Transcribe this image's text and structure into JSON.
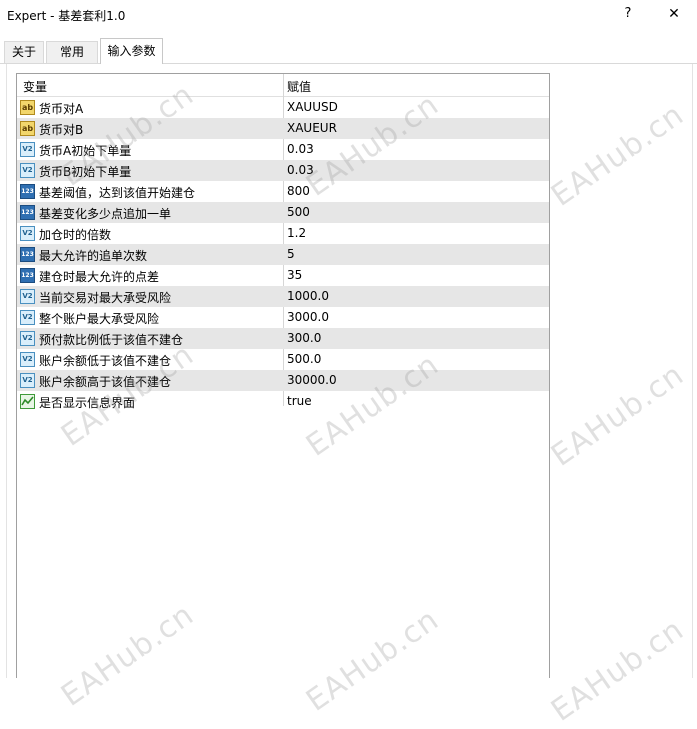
{
  "window": {
    "title": "Expert - 基差套利1.0",
    "help": "?",
    "close": "✕"
  },
  "tabs": [
    {
      "label": "关于",
      "active": false
    },
    {
      "label": "常用",
      "active": false
    },
    {
      "label": "输入参数",
      "active": true
    }
  ],
  "table": {
    "headers": {
      "variable": "变量",
      "value": "赋值"
    },
    "rows": [
      {
        "icon": "ab-string-icon",
        "name": "货币对A",
        "value": "XAUUSD"
      },
      {
        "icon": "ab-string-icon",
        "name": "货币对B",
        "value": "XAUEUR"
      },
      {
        "icon": "va-double-icon",
        "name": "货币A初始下单量",
        "value": "0.03"
      },
      {
        "icon": "va-double-icon",
        "name": "货币B初始下单量",
        "value": "0.03"
      },
      {
        "icon": "int-123-icon",
        "name": "基差阈值，达到该值开始建仓",
        "value": "800"
      },
      {
        "icon": "int-123-icon",
        "name": "基差变化多少点追加一单",
        "value": "500"
      },
      {
        "icon": "va-double-icon",
        "name": "加仓时的倍数",
        "value": "1.2"
      },
      {
        "icon": "int-123-icon",
        "name": "最大允许的追单次数",
        "value": "5"
      },
      {
        "icon": "int-123-icon",
        "name": "建仓时最大允许的点差",
        "value": "35"
      },
      {
        "icon": "va-double-icon",
        "name": "当前交易对最大承受风险",
        "value": "1000.0"
      },
      {
        "icon": "va-double-icon",
        "name": "整个账户最大承受风险",
        "value": "3000.0"
      },
      {
        "icon": "va-double-icon",
        "name": "预付款比例低于该值不建仓",
        "value": "300.0"
      },
      {
        "icon": "va-double-icon",
        "name": "账户余额低于该值不建仓",
        "value": "500.0"
      },
      {
        "icon": "va-double-icon",
        "name": "账户余额高于该值不建仓",
        "value": "30000.0"
      },
      {
        "icon": "bool-icon",
        "name": "是否显示信息界面",
        "value": "true"
      }
    ]
  },
  "watermark": {
    "text": "EAHub.cn"
  },
  "icon_labels": {
    "string": "ab",
    "double": "V2",
    "int": "123"
  }
}
